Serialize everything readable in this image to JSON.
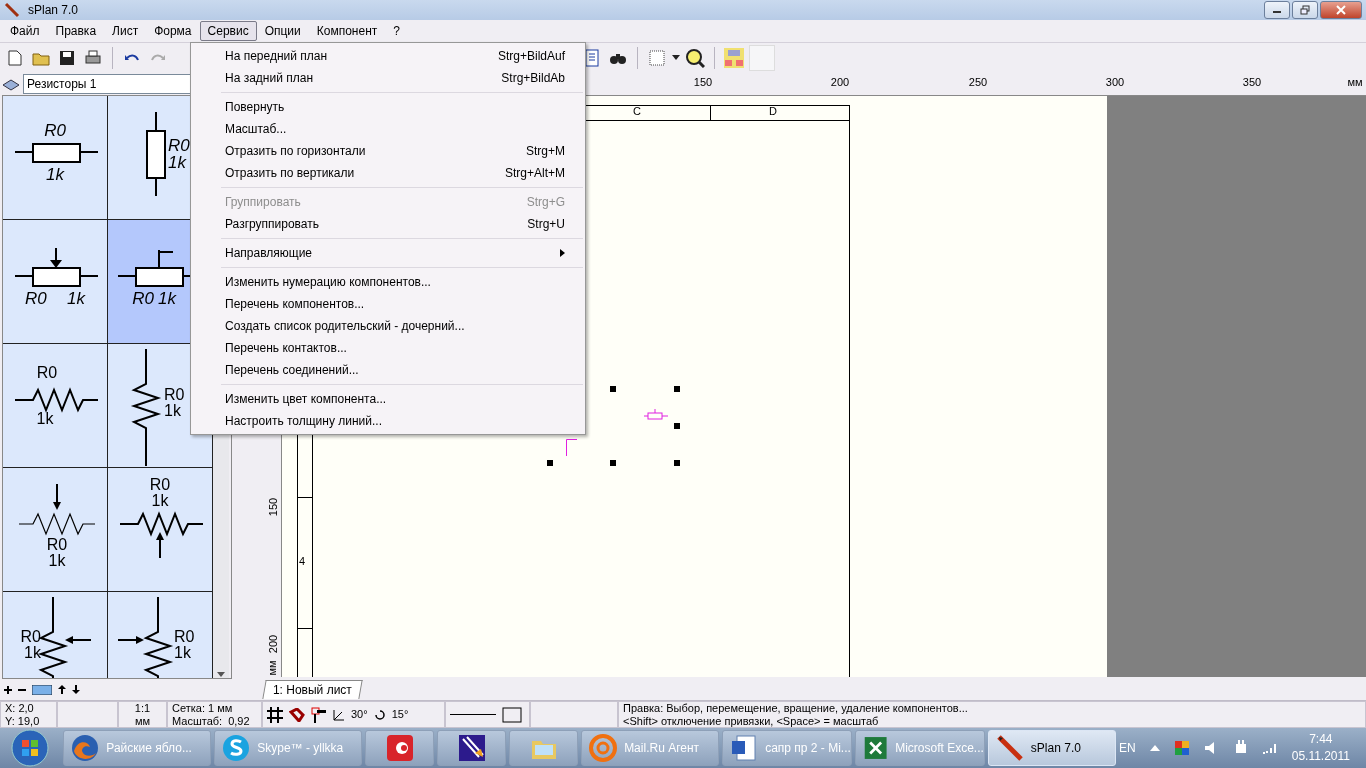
{
  "window": {
    "title": "sPlan 7.0"
  },
  "menubar": [
    {
      "label": "Файл",
      "selected": false
    },
    {
      "label": "Правка",
      "selected": false
    },
    {
      "label": "Лист",
      "selected": false
    },
    {
      "label": "Форма",
      "selected": false
    },
    {
      "label": "Сервис",
      "selected": true
    },
    {
      "label": "Опции",
      "selected": false
    },
    {
      "label": "Компонент",
      "selected": false
    },
    {
      "label": "?",
      "selected": false
    }
  ],
  "menu": [
    {
      "kind": "item",
      "label": "На передний план",
      "shortcut": "Strg+BildAuf",
      "disabled": false
    },
    {
      "kind": "item",
      "label": "На задний план",
      "shortcut": "Strg+BildAb",
      "disabled": false
    },
    {
      "kind": "separator"
    },
    {
      "kind": "item",
      "label": "Повернуть",
      "disabled": false
    },
    {
      "kind": "item",
      "label": "Масштаб...",
      "disabled": false
    },
    {
      "kind": "item",
      "label": "Отразить по горизонтали",
      "shortcut": "Strg+M",
      "disabled": false
    },
    {
      "kind": "item",
      "label": "Отразить по вертикали",
      "shortcut": "Strg+Alt+M",
      "disabled": false
    },
    {
      "kind": "separator"
    },
    {
      "kind": "item",
      "label": "Группировать",
      "shortcut": "Strg+G",
      "disabled": true
    },
    {
      "kind": "item",
      "label": "Разгруппировать",
      "shortcut": "Strg+U",
      "disabled": false
    },
    {
      "kind": "separator"
    },
    {
      "kind": "submenu",
      "label": "Направляющие",
      "disabled": false
    },
    {
      "kind": "separator"
    },
    {
      "kind": "item",
      "label": "Изменить нумерацию компонентов...",
      "disabled": false
    },
    {
      "kind": "item",
      "label": "Перечень компонентов...",
      "disabled": false
    },
    {
      "kind": "item",
      "label": "Создать список родительский - дочерний...",
      "disabled": false
    },
    {
      "kind": "item",
      "label": "Перечень контактов...",
      "disabled": false
    },
    {
      "kind": "item",
      "label": "Перечень соединений...",
      "disabled": false
    },
    {
      "kind": "separator"
    },
    {
      "kind": "item",
      "label": "Изменить цвет компонента...",
      "disabled": false
    },
    {
      "kind": "item",
      "label": "Настроить толщину линий...",
      "disabled": false
    }
  ],
  "library": {
    "value": "Резисторы 1"
  },
  "components": [
    {
      "kind": "box-h",
      "name": "R0",
      "value": "1k",
      "selected": false
    },
    {
      "kind": "box-v",
      "name": "R0",
      "value": "1k",
      "selected": false
    },
    {
      "kind": "pot-arrow",
      "name": "R0",
      "value": "1k",
      "selected": false
    },
    {
      "kind": "pot-trim",
      "name": "R0",
      "value": "1k",
      "selected": true
    },
    {
      "kind": "zigzag-h",
      "name": "R0",
      "value": "1k",
      "selected": false
    },
    {
      "kind": "zigzag-v",
      "name": "R0",
      "value": "1k",
      "selected": false
    },
    {
      "kind": "zigzag-pot-top",
      "name": "R0",
      "value": "1k",
      "selected": false
    },
    {
      "kind": "zigzag-pot-bottom",
      "name": "R0",
      "value": "1k",
      "selected": false
    },
    {
      "kind": "zigzag-v-arrow-left",
      "name": "R0",
      "value": "1k",
      "selected": false
    },
    {
      "kind": "zigzag-v-arrow-right",
      "name": "R0",
      "value": "1k",
      "selected": false
    }
  ],
  "ruler": {
    "top_labels": [
      "150",
      "200",
      "250",
      "300",
      "350"
    ],
    "top_unit": "мм",
    "left_labels": [
      "150",
      "200"
    ],
    "left_unit": "мм"
  },
  "sheet": {
    "column_headers": [
      "C",
      "D"
    ],
    "row_labels": [
      "4"
    ]
  },
  "sheet_tabs": [
    {
      "label": "1: Новый лист",
      "selected": true
    }
  ],
  "status_bar": {
    "x": "X: 2,0",
    "y": "Y: 19,0",
    "scale_ratio": "1:1",
    "unit": "мм",
    "grid": "Сетка: 1 мм",
    "zoom_label": "Масштаб:",
    "zoom": "0,92",
    "angle": "30°",
    "rotation": "15°",
    "hint_1": "Правка: Выбор, перемещение, вращение, удаление компонентов...",
    "hint_2": "<Shift> отключение привязки, <Space> =  масштаб"
  },
  "taskbar": {
    "tasks": [
      {
        "kind": "firefox",
        "label": "Райские ябло...",
        "selected": false
      },
      {
        "kind": "skype",
        "label": "Skype™ - yllkka",
        "selected": false
      },
      {
        "kind": "red-app",
        "selected": false
      },
      {
        "kind": "purple-app",
        "selected": false
      },
      {
        "kind": "folder",
        "selected": false
      },
      {
        "kind": "mail",
        "label": "Mail.Ru Агент",
        "selected": false
      },
      {
        "kind": "word",
        "label": "сапр пр 2 - Mi...",
        "selected": false
      },
      {
        "kind": "excel",
        "label": "Microsoft Exce...",
        "selected": false
      },
      {
        "kind": "pencil",
        "label": "sPlan 7.0",
        "selected": true
      }
    ],
    "language": "EN",
    "time": "7:44",
    "date": "05.11.2011"
  }
}
